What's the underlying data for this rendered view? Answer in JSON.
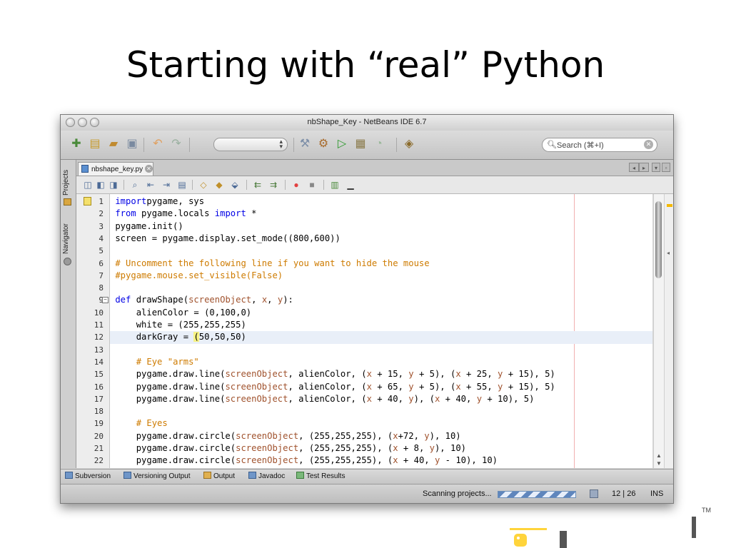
{
  "slide": {
    "title": "Starting with “real” Python",
    "trademark": "TM"
  },
  "window": {
    "title": "nbShape_Key - NetBeans IDE 6.7"
  },
  "toolbar": {
    "search_placeholder": "Search (⌘+I)"
  },
  "sidebar": {
    "tabs": [
      "Projects",
      "Navigator"
    ]
  },
  "editor": {
    "file_tab": "nbshape_key.py",
    "current_line": 12,
    "lines": [
      {
        "n": 1,
        "segs": [
          [
            "kw",
            "import"
          ],
          [
            "",
            "pygame, sys"
          ]
        ]
      },
      {
        "n": 2,
        "segs": [
          [
            "kw",
            "from"
          ],
          [
            "",
            " pygame.locals "
          ],
          [
            "kw",
            "import"
          ],
          [
            "",
            " *"
          ]
        ]
      },
      {
        "n": 3,
        "segs": [
          [
            "",
            "pygame.init()"
          ]
        ]
      },
      {
        "n": 4,
        "segs": [
          [
            "",
            "screen = pygame.display.set_mode((800,600))"
          ]
        ]
      },
      {
        "n": 5,
        "segs": []
      },
      {
        "n": 6,
        "segs": [
          [
            "cm",
            "# Uncomment the following line if you want to hide the mouse"
          ]
        ]
      },
      {
        "n": 7,
        "segs": [
          [
            "cm",
            "#pygame.mouse.set_visible(False)"
          ]
        ]
      },
      {
        "n": 8,
        "segs": []
      },
      {
        "n": 9,
        "segs": [
          [
            "kw",
            "def"
          ],
          [
            "",
            " drawShape("
          ],
          [
            "pa",
            "screenObject"
          ],
          [
            "",
            ", "
          ],
          [
            "pa",
            "x"
          ],
          [
            "",
            ", "
          ],
          [
            "pa",
            "y"
          ],
          [
            "",
            "):"
          ]
        ]
      },
      {
        "n": 10,
        "segs": [
          [
            "",
            "    alienColor = (0,100,0)"
          ]
        ]
      },
      {
        "n": 11,
        "segs": [
          [
            "",
            "    white = (255,255,255)"
          ]
        ]
      },
      {
        "n": 12,
        "segs": [
          [
            "",
            "    darkGray = "
          ],
          [
            "bm",
            "("
          ],
          [
            "",
            "50,50,50)"
          ]
        ]
      },
      {
        "n": 13,
        "segs": []
      },
      {
        "n": 14,
        "segs": [
          [
            "",
            "    "
          ],
          [
            "cm",
            "# Eye \"arms\""
          ]
        ]
      },
      {
        "n": 15,
        "segs": [
          [
            "",
            "    pygame.draw.line("
          ],
          [
            "pa",
            "screenObject"
          ],
          [
            "",
            ", alienColor, ("
          ],
          [
            "pa",
            "x"
          ],
          [
            "",
            " + 15, "
          ],
          [
            "pa",
            "y"
          ],
          [
            "",
            " + 5), ("
          ],
          [
            "pa",
            "x"
          ],
          [
            "",
            " + 25, "
          ],
          [
            "pa",
            "y"
          ],
          [
            "",
            " + 15), 5)"
          ]
        ]
      },
      {
        "n": 16,
        "segs": [
          [
            "",
            "    pygame.draw.line("
          ],
          [
            "pa",
            "screenObject"
          ],
          [
            "",
            ", alienColor, ("
          ],
          [
            "pa",
            "x"
          ],
          [
            "",
            " + 65, "
          ],
          [
            "pa",
            "y"
          ],
          [
            "",
            " + 5), ("
          ],
          [
            "pa",
            "x"
          ],
          [
            "",
            " + 55, "
          ],
          [
            "pa",
            "y"
          ],
          [
            "",
            " + 15), 5)"
          ]
        ]
      },
      {
        "n": 17,
        "segs": [
          [
            "",
            "    pygame.draw.line("
          ],
          [
            "pa",
            "screenObject"
          ],
          [
            "",
            ", alienColor, ("
          ],
          [
            "pa",
            "x"
          ],
          [
            "",
            " + 40, "
          ],
          [
            "pa",
            "y"
          ],
          [
            "",
            "), ("
          ],
          [
            "pa",
            "x"
          ],
          [
            "",
            " + 40, "
          ],
          [
            "pa",
            "y"
          ],
          [
            "",
            " + 10), 5)"
          ]
        ]
      },
      {
        "n": 18,
        "segs": []
      },
      {
        "n": 19,
        "segs": [
          [
            "",
            "    "
          ],
          [
            "cm",
            "# Eyes"
          ]
        ]
      },
      {
        "n": 20,
        "segs": [
          [
            "",
            "    pygame.draw.circle("
          ],
          [
            "pa",
            "screenObject"
          ],
          [
            "",
            ", (255,255,255), ("
          ],
          [
            "pa",
            "x"
          ],
          [
            "",
            "+72, "
          ],
          [
            "pa",
            "y"
          ],
          [
            "",
            "), 10)"
          ]
        ]
      },
      {
        "n": 21,
        "segs": [
          [
            "",
            "    pygame.draw.circle("
          ],
          [
            "pa",
            "screenObject"
          ],
          [
            "",
            ", (255,255,255), ("
          ],
          [
            "pa",
            "x"
          ],
          [
            "",
            " + 8, "
          ],
          [
            "pa",
            "y"
          ],
          [
            "",
            "), 10)"
          ]
        ]
      },
      {
        "n": 22,
        "segs": [
          [
            "",
            "    pygame.draw.circle("
          ],
          [
            "pa",
            "screenObject"
          ],
          [
            "",
            ", (255,255,255), ("
          ],
          [
            "pa",
            "x"
          ],
          [
            "",
            " + 40, "
          ],
          [
            "pa",
            "y"
          ],
          [
            "",
            " - 10), 10)"
          ]
        ]
      }
    ]
  },
  "bottom_tabs": [
    "Subversion",
    "Versioning Output",
    "Output",
    "Javadoc",
    "Test Results"
  ],
  "status": {
    "text": "Scanning projects...",
    "position": "12 | 26",
    "mode": "INS"
  },
  "icons": [
    "new-project-icon",
    "new-file-icon",
    "open-project-icon",
    "save-all-icon",
    "undo-icon",
    "redo-icon",
    "clean-build-icon",
    "build-icon",
    "run-icon",
    "debug-icon",
    "profile-icon",
    "apply-code-changes-icon"
  ],
  "colors": {
    "keyword": "#0000e6",
    "comment": "#ce7b00",
    "parameter": "#a0522d",
    "current_line": "#e9eff8"
  }
}
